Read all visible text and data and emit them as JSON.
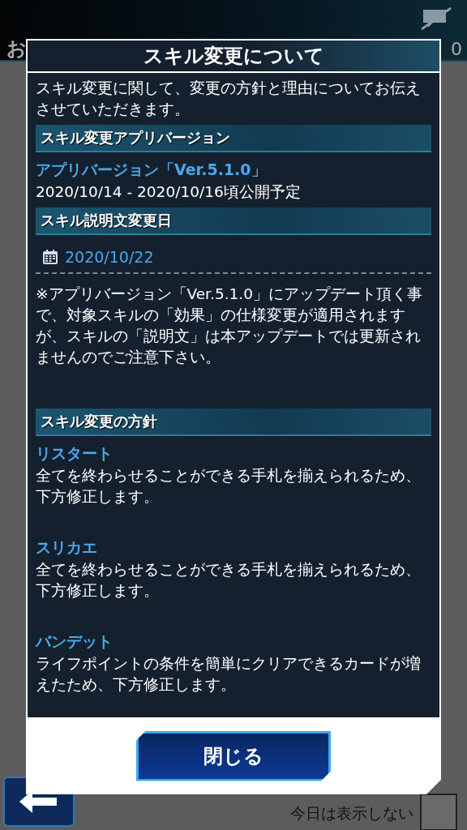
{
  "background": {
    "header_title": "お",
    "header_count": "0",
    "hide_today_label": "今日は表示しない",
    "hide_today_checked": false
  },
  "dialog": {
    "title": "スキル変更について",
    "blocks": [
      {
        "kind": "text",
        "text": "スキル変更に関して、変更の方針と理由についてお伝えさせていただきます。"
      },
      {
        "kind": "heading",
        "text": "スキル変更アプリバージョン"
      },
      {
        "kind": "subtitle",
        "text": "アプリバージョン「Ver.5.1.0」"
      },
      {
        "kind": "text",
        "text": "2020/10/14 - 2020/10/16頃公開予定"
      },
      {
        "kind": "heading",
        "text": "スキル説明文変更日"
      },
      {
        "kind": "date",
        "text": "2020/10/22"
      },
      {
        "kind": "note",
        "text": "※アプリバージョン「Ver.5.1.0」にアップデート頂く事で、対象スキルの「効果」の仕様変更が適用されますが、スキルの「説明文」は本アップデートでは更新されませんのでご注意下さい。"
      },
      {
        "kind": "heading",
        "text": "スキル変更の方針"
      },
      {
        "kind": "subtitle",
        "text": "リスタート"
      },
      {
        "kind": "text",
        "text": "全てを終わらせることができる手札を揃えられるため、下方修正します。"
      },
      {
        "kind": "subtitle",
        "text": "スリカエ"
      },
      {
        "kind": "text",
        "text": "全てを終わらせることができる手札を揃えられるため、下方修正します。"
      },
      {
        "kind": "subtitle",
        "text": "バンデット"
      },
      {
        "kind": "text",
        "text": "ライフポイントの条件を簡単にクリアできるカードが増えたため、下方修正します。"
      }
    ],
    "close_button": "閉じる"
  }
}
